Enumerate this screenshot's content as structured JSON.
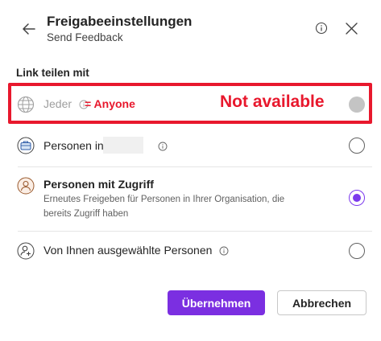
{
  "header": {
    "title": "Freigabeeinstellungen",
    "subtitle": "Send Feedback"
  },
  "section": {
    "label": "Link teilen mit"
  },
  "options": [
    {
      "label": "Jeder",
      "icon": "globe-icon",
      "state": "disabled"
    },
    {
      "label": "Personen in",
      "icon": "briefcase-icon",
      "state": "unselected"
    },
    {
      "label": "Personen mit Zugriff",
      "description": "Erneutes Freigeben für Personen in Ihrer Organisation, die bereits Zugriff haben",
      "icon": "person-icon",
      "state": "selected"
    },
    {
      "label": "Von Ihnen ausgewählte Personen",
      "icon": "person-add-icon",
      "state": "unselected"
    }
  ],
  "annotation": {
    "anyone": "= Anyone",
    "not_available": "Not available",
    "color": "#e8182d"
  },
  "buttons": {
    "apply": "Übernehmen",
    "cancel": "Abbrechen"
  },
  "colors": {
    "accent": "#7b2fe1",
    "disabled_radio": "#c4c4c4"
  }
}
